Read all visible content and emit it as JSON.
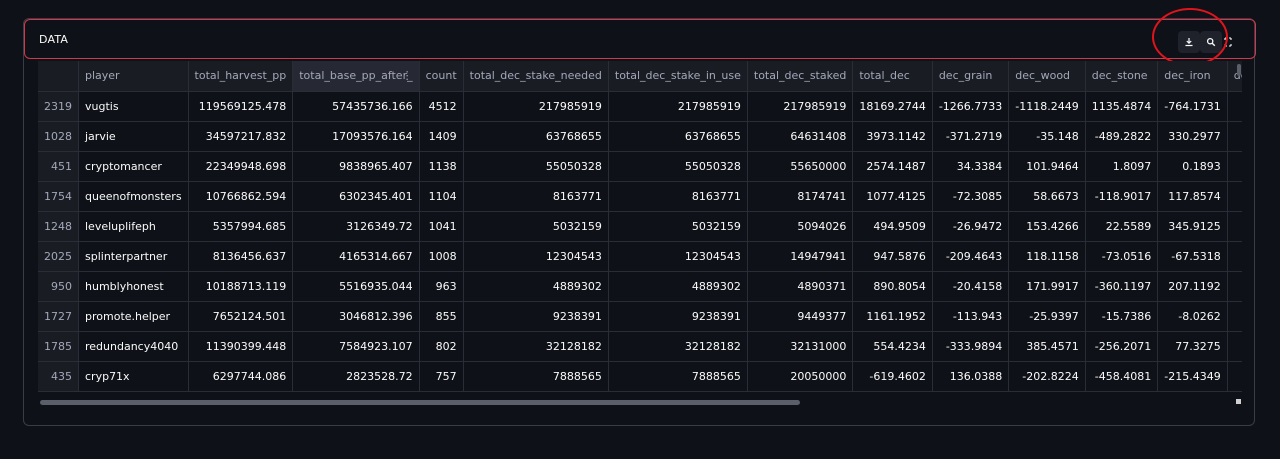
{
  "expander": {
    "title": "DATA"
  },
  "toolbar": {
    "download_icon": "download-icon",
    "search_icon": "search-icon",
    "fullscreen_icon": "fullscreen-icon"
  },
  "colors": {
    "accent_border": "#d1394a",
    "annotation": "#e0141c",
    "background": "#0e1117"
  },
  "table": {
    "columns": [
      "",
      "player",
      "total_harvest_pp",
      "total_base_pp_after_",
      "count",
      "total_dec_stake_needed",
      "total_dec_stake_in_use",
      "total_dec_staked",
      "total_dec",
      "dec_grain",
      "dec_wood",
      "dec_stone",
      "dec_iron",
      "dec_resea"
    ],
    "rows": [
      [
        "2319",
        "vugtis",
        "119569125.478",
        "57435736.166",
        "4512",
        "217985919",
        "217985919",
        "217985919",
        "18169.2744",
        "-1266.7733",
        "-1118.2449",
        "1135.4874",
        "-764.1731",
        ""
      ],
      [
        "1028",
        "jarvie",
        "34597217.832",
        "17093576.164",
        "1409",
        "63768655",
        "63768655",
        "64631408",
        "3973.1142",
        "-371.2719",
        "-35.148",
        "-489.2822",
        "330.2977",
        ""
      ],
      [
        "451",
        "cryptomancer",
        "22349948.698",
        "9838965.407",
        "1138",
        "55050328",
        "55050328",
        "55650000",
        "2574.1487",
        "34.3384",
        "101.9464",
        "1.8097",
        "0.1893",
        ""
      ],
      [
        "1754",
        "queenofmonsters",
        "10766862.594",
        "6302345.401",
        "1104",
        "8163771",
        "8163771",
        "8174741",
        "1077.4125",
        "-72.3085",
        "58.6673",
        "-118.9017",
        "117.8574",
        ""
      ],
      [
        "1248",
        "leveluplifeph",
        "5357994.685",
        "3126349.72",
        "1041",
        "5032159",
        "5032159",
        "5094026",
        "494.9509",
        "-26.9472",
        "153.4266",
        "22.5589",
        "345.9125",
        ""
      ],
      [
        "2025",
        "splinterpartner",
        "8136456.637",
        "4165314.667",
        "1008",
        "12304543",
        "12304543",
        "14947941",
        "947.5876",
        "-209.4643",
        "118.1158",
        "-73.0516",
        "-67.5318",
        ""
      ],
      [
        "950",
        "humblyhonest",
        "10188713.119",
        "5516935.044",
        "963",
        "4889302",
        "4889302",
        "4890371",
        "890.8054",
        "-20.4158",
        "171.9917",
        "-360.1197",
        "207.1192",
        ""
      ],
      [
        "1727",
        "promote.helper",
        "7652124.501",
        "3046812.396",
        "855",
        "9238391",
        "9238391",
        "9449377",
        "1161.1952",
        "-113.943",
        "-25.9397",
        "-15.7386",
        "-8.0262",
        ""
      ],
      [
        "1785",
        "redundancy4040",
        "11390399.448",
        "7584923.107",
        "802",
        "32128182",
        "32128182",
        "32131000",
        "554.4234",
        "-333.9894",
        "385.4571",
        "-256.2071",
        "77.3275",
        ""
      ],
      [
        "435",
        "cryp71x",
        "6297744.086",
        "2823528.72",
        "757",
        "7888565",
        "7888565",
        "20050000",
        "-619.4602",
        "136.0388",
        "-202.8224",
        "-458.4081",
        "-215.4349",
        ""
      ]
    ]
  }
}
